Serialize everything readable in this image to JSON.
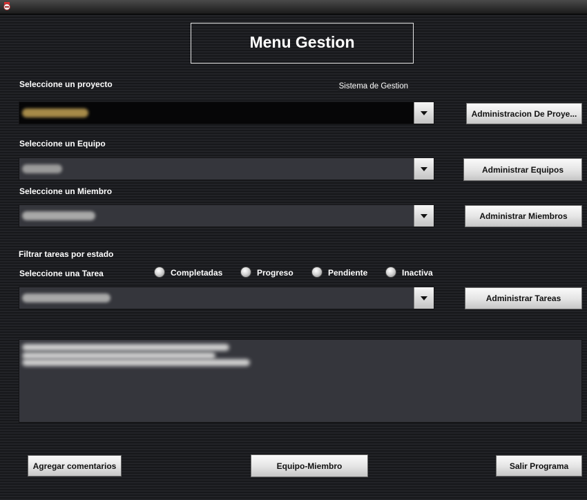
{
  "window": {
    "icon": "app-icon"
  },
  "header": {
    "title": "Menu Gestion",
    "subtitle": "Sistema de Gestion"
  },
  "project": {
    "label": "Seleccione un proyecto",
    "selected": "",
    "button": "Administracion De Proye..."
  },
  "team": {
    "label": "Seleccione un Equipo",
    "selected": "",
    "button": "Administrar Equipos"
  },
  "member": {
    "label": "Seleccione un Miembro",
    "selected": "",
    "button": "Administrar Miembros"
  },
  "filter": {
    "label": "Filtrar tareas por estado",
    "options": [
      "Completadas",
      "Progreso",
      "Pendiente",
      "Inactiva"
    ]
  },
  "task": {
    "label": "Seleccione una Tarea",
    "selected": "",
    "button": "Administrar Tareas"
  },
  "comments": {
    "text": ""
  },
  "footer": {
    "add_comments": "Agregar comentarios",
    "team_member": "Equipo-Miembro",
    "exit": "Salir Programa"
  }
}
